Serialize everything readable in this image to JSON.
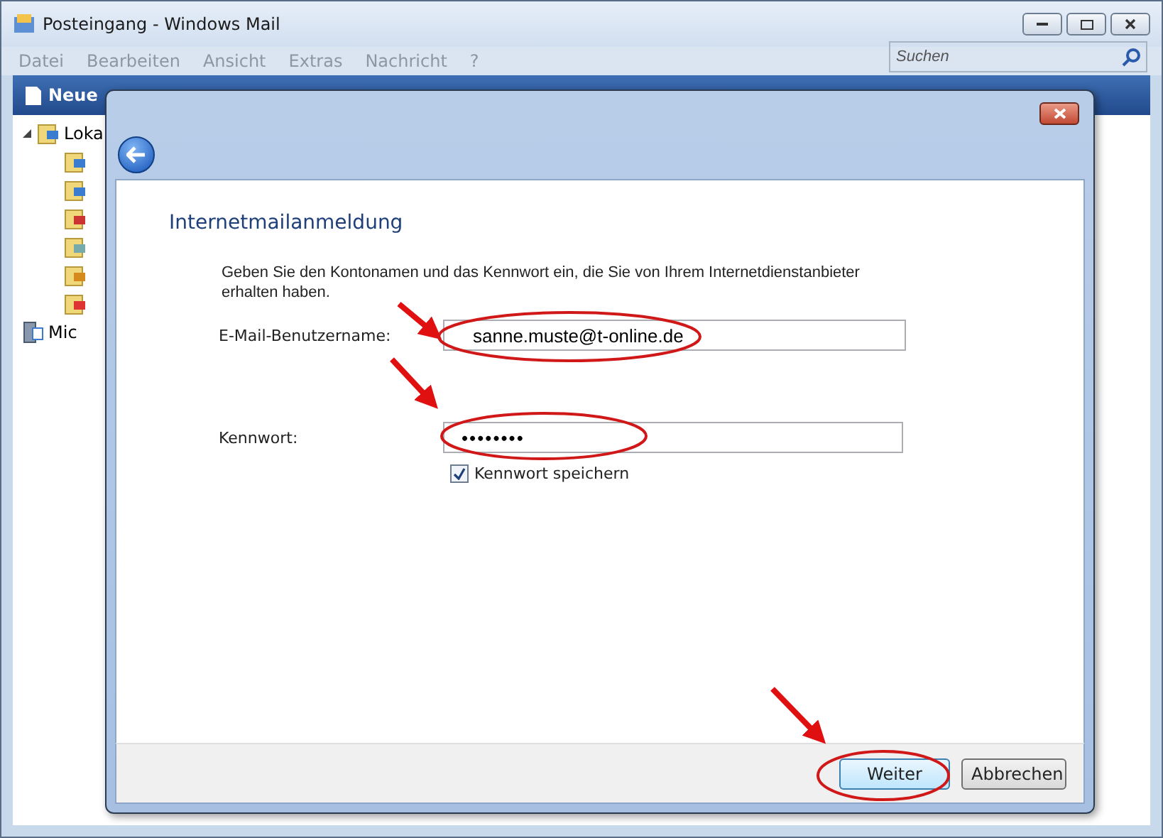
{
  "main_window": {
    "title": "Posteingang - Windows Mail",
    "menu": [
      "Datei",
      "Bearbeiten",
      "Ansicht",
      "Extras",
      "Nachricht",
      "?"
    ],
    "search": {
      "placeholder": "Suchen"
    },
    "toolbar": {
      "first_button": "Neue"
    },
    "folders": [
      {
        "label": "Loka",
        "expanded": true,
        "children": [
          {
            "kind": "inbox"
          },
          {
            "kind": "outbox"
          },
          {
            "kind": "sent"
          },
          {
            "kind": "deleted"
          },
          {
            "kind": "drafts"
          },
          {
            "kind": "junk"
          }
        ]
      },
      {
        "label": "Mic",
        "kind": "newsgroup"
      }
    ]
  },
  "dialog": {
    "heading": "Internetmailanmeldung",
    "description": "Geben Sie den Kontonamen und das Kennwort ein, die Sie von Ihrem Internetdienstanbieter erhalten haben.",
    "fields": [
      {
        "label": "E-Mail-Benutzername:",
        "value": "sanne.muste@t-online.de",
        "kind": "text"
      },
      {
        "label": "Kennwort:",
        "value": "••••••••",
        "kind": "password"
      }
    ],
    "remember": {
      "label": "Kennwort speichern",
      "checked": true
    },
    "buttons": [
      {
        "label": "Weiter",
        "default": true
      },
      {
        "label": "Abbrechen",
        "default": false
      }
    ]
  }
}
